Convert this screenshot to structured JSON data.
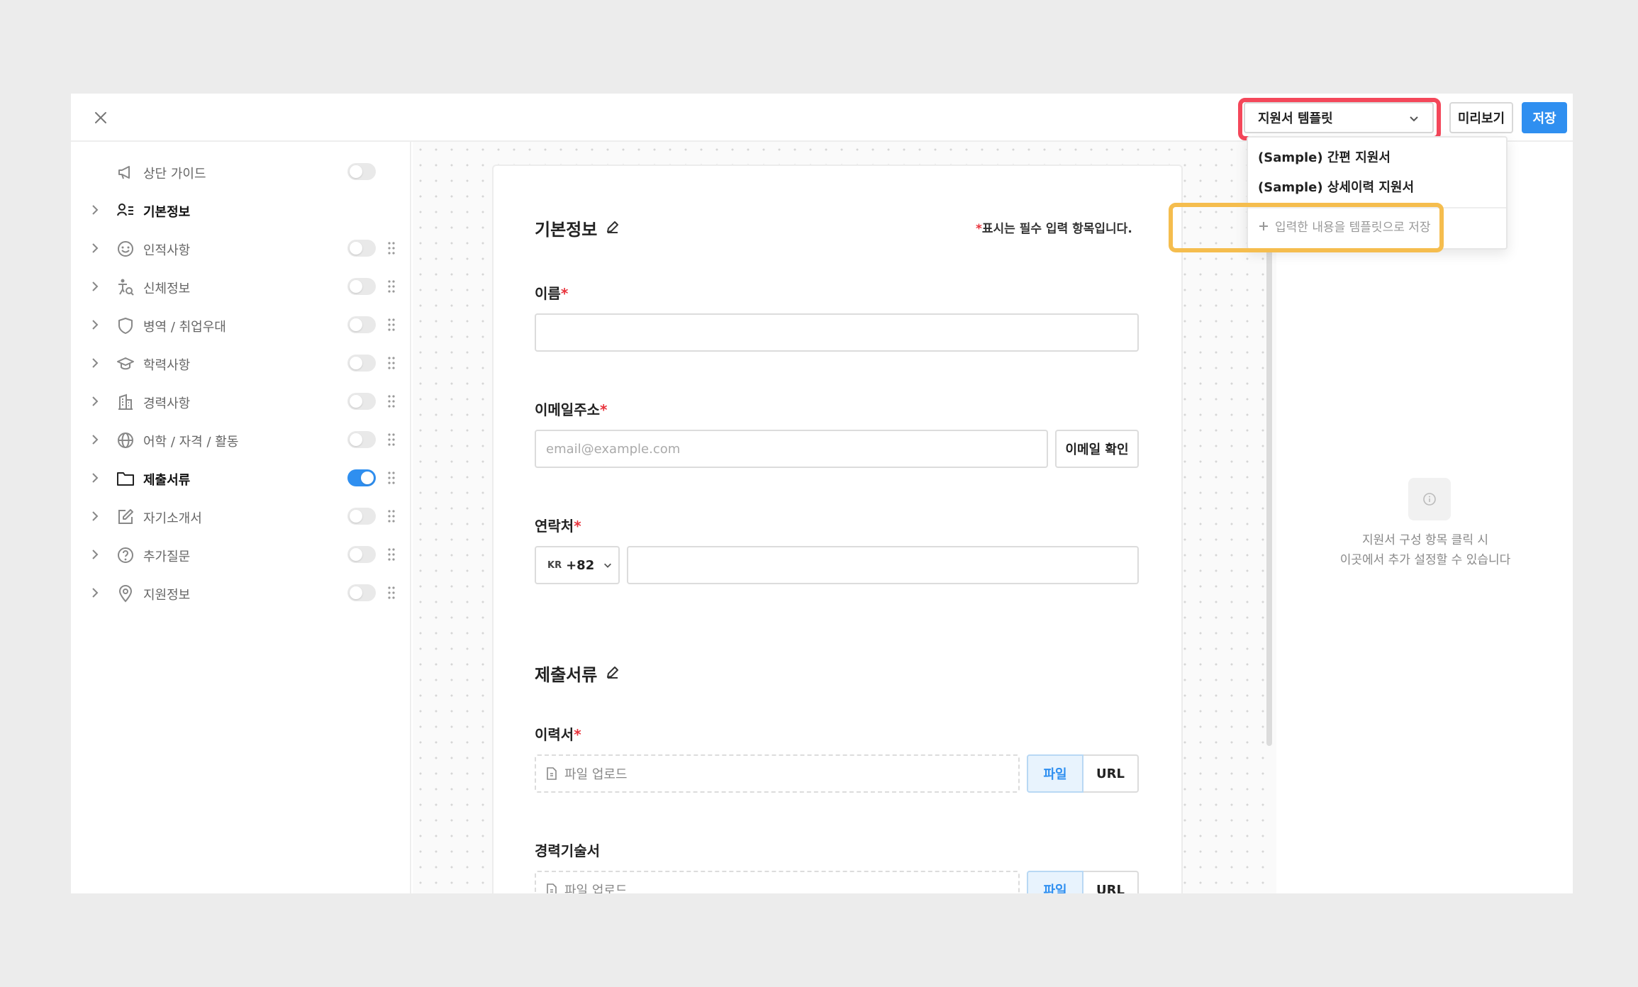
{
  "header": {
    "template_select_value": "지원서 템플릿",
    "preview_label": "미리보기",
    "save_label": "저장"
  },
  "sidebar": {
    "items": [
      {
        "label": "상단 가이드",
        "icon": "megaphone-icon",
        "toggle": false,
        "has_arrow": false,
        "has_drag": false,
        "active": false
      },
      {
        "label": "기본정보",
        "icon": "person-list-icon",
        "toggle": null,
        "has_arrow": true,
        "has_drag": false,
        "active": true
      },
      {
        "label": "인적사항",
        "icon": "smile-icon",
        "toggle": false,
        "has_arrow": true,
        "has_drag": true,
        "active": false
      },
      {
        "label": "신체정보",
        "icon": "body-search-icon",
        "toggle": false,
        "has_arrow": true,
        "has_drag": true,
        "active": false
      },
      {
        "label": "병역 / 취업우대",
        "icon": "shield-icon",
        "toggle": false,
        "has_arrow": true,
        "has_drag": true,
        "active": false
      },
      {
        "label": "학력사항",
        "icon": "graduation-cap-icon",
        "toggle": false,
        "has_arrow": true,
        "has_drag": true,
        "active": false
      },
      {
        "label": "경력사항",
        "icon": "building-icon",
        "toggle": false,
        "has_arrow": true,
        "has_drag": true,
        "active": false
      },
      {
        "label": "어학 / 자격 / 활동",
        "icon": "globe-icon",
        "toggle": false,
        "has_arrow": true,
        "has_drag": true,
        "active": false
      },
      {
        "label": "제출서류",
        "icon": "folder-icon",
        "toggle": true,
        "has_arrow": true,
        "has_drag": true,
        "active": true
      },
      {
        "label": "자기소개서",
        "icon": "edit-note-icon",
        "toggle": false,
        "has_arrow": true,
        "has_drag": true,
        "active": false
      },
      {
        "label": "추가질문",
        "icon": "question-icon",
        "toggle": false,
        "has_arrow": true,
        "has_drag": true,
        "active": false
      },
      {
        "label": "지원정보",
        "icon": "location-pin-icon",
        "toggle": false,
        "has_arrow": true,
        "has_drag": true,
        "active": false
      }
    ]
  },
  "form": {
    "basic_title": "기본정보",
    "required_note_star": "*",
    "required_note_text": "표시는 필수 입력 항목입니다.",
    "name_label": "이름",
    "email_label": "이메일주소",
    "email_placeholder": "email@example.com",
    "email_verify": "이메일 확인",
    "phone_label": "연락처",
    "country_flag": "KR",
    "country_code": "+82",
    "docs_title": "제출서류",
    "resume_label": "이력서",
    "upload_placeholder": "파일 업로드",
    "file_label": "파일",
    "url_label": "URL",
    "career_label": "경력기술서",
    "star": "*"
  },
  "dropdown": {
    "items": [
      "(Sample) 간편 지원서",
      "(Sample) 상세이력 지원서"
    ],
    "add_label": "입력한 내용을 템플릿으로 저장"
  },
  "info_panel": {
    "line1": "지원서 구성 항목 클릭 시",
    "line2": "이곳에서 추가 설정할 수 있습니다"
  },
  "colors": {
    "accent": "#2f8ff0",
    "required": "#e8333c",
    "highlight_red": "#f4475a",
    "highlight_yellow": "#f5bd4e"
  }
}
